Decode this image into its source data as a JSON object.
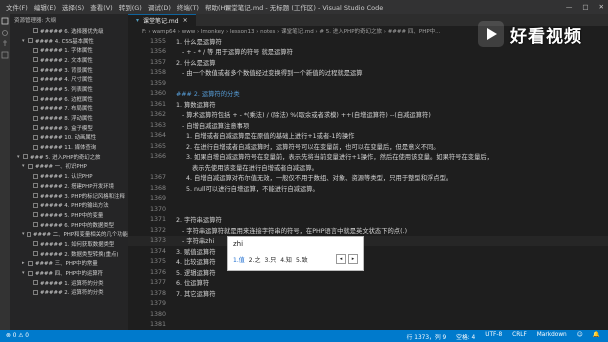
{
  "titlebar": {
    "menu": [
      "文件(F)",
      "编辑(E)",
      "选择(S)",
      "查看(V)",
      "转到(G)",
      "调试(D)",
      "终端(T)",
      "帮助(H)"
    ],
    "title": "课堂笔记.md - 无标题 (工作区) - Visual Studio Code",
    "minimize": "—",
    "maximize": "□",
    "close": "✕"
  },
  "sidebar": {
    "header": "资源管理器: 大纲",
    "items": [
      {
        "label": "##### 6. 选择器优先级",
        "indent": 3
      },
      {
        "label": "#### 4. CSS基本属性",
        "indent": 2,
        "expanded": true
      },
      {
        "label": "##### 1. 字体属性",
        "indent": 3
      },
      {
        "label": "##### 2. 文本属性",
        "indent": 3
      },
      {
        "label": "##### 3. 背景属性",
        "indent": 3
      },
      {
        "label": "##### 4. 尺寸属性",
        "indent": 3
      },
      {
        "label": "##### 5. 列表属性",
        "indent": 3
      },
      {
        "label": "##### 6. 边框属性",
        "indent": 3
      },
      {
        "label": "##### 7. 布局属性",
        "indent": 3
      },
      {
        "label": "##### 8. 浮动属性",
        "indent": 3
      },
      {
        "label": "##### 9. 盒子模型",
        "indent": 3
      },
      {
        "label": "##### 10. 动画属性",
        "indent": 3
      },
      {
        "label": "##### 11. 媒体查询",
        "indent": 3
      },
      {
        "label": "### 5. 进入PHP的奇幻之旅",
        "indent": 1,
        "expanded": true
      },
      {
        "label": "#### 一、初识PHP",
        "indent": 2,
        "expanded": true
      },
      {
        "label": "##### 1. 认识PHP",
        "indent": 3
      },
      {
        "label": "##### 2. 搭建PHP开发环境",
        "indent": 3
      },
      {
        "label": "##### 3. PHP的标记风格和注释",
        "indent": 3
      },
      {
        "label": "##### 4. PHP的输出方法",
        "indent": 3
      },
      {
        "label": "##### 5. PHP中的变量",
        "indent": 3
      },
      {
        "label": "##### 6. PHP中的数据类型",
        "indent": 3
      },
      {
        "label": "#### 二、PHP和变量相关的几个功能",
        "indent": 2,
        "expanded": true
      },
      {
        "label": "##### 1. 如何获取数据类型",
        "indent": 3
      },
      {
        "label": "##### 2. 数据类型转换(重点)",
        "indent": 3
      },
      {
        "label": "#### 三、PHP中的常量",
        "indent": 2,
        "expanded": false
      },
      {
        "label": "#### 四、PHP中的运算符",
        "indent": 2,
        "expanded": true
      },
      {
        "label": "##### 1. 运算符的分类",
        "indent": 3
      },
      {
        "label": "##### 2. 运算符的分类",
        "indent": 3
      }
    ]
  },
  "tabs": [
    {
      "label": "课堂笔记.md",
      "close": "×"
    }
  ],
  "breadcrumb": "F: › wamp64 › www › lmonkey › lesson13 › notes › 课堂笔记.md › # 5. 进入PHP的奇幻之旅 › #### 四、PHP中...",
  "editor": {
    "lines": [
      {
        "n": "1355",
        "text": "1. 什么是运算符",
        "style": "normal"
      },
      {
        "n": "1356",
        "text": "   - + - * / 等 用于运算的符号 就是运算符",
        "style": "normal"
      },
      {
        "n": "1357",
        "text": "2. 什么是运算",
        "style": "normal"
      },
      {
        "n": "1358",
        "text": "   - 由一个数值或者多个数值经过变换得到一个新值的过程就是运算",
        "style": "normal"
      },
      {
        "n": "1359",
        "text": "",
        "style": "normal"
      },
      {
        "n": "1360",
        "text": "### 2. 运算符的分类",
        "style": "heading"
      },
      {
        "n": "1361",
        "text": "1. 算数运算符",
        "style": "normal"
      },
      {
        "n": "1362",
        "text": "   - 算术运算符包括 + - *(乘法) / (除法) %(取余或者求模) ++(自增运算符) --(自减运算符)",
        "style": "normal"
      },
      {
        "n": "1363",
        "text": "   - 自增自减运算注意事项",
        "style": "normal"
      },
      {
        "n": "1364",
        "text": "     1. 自增或者自减运算是在原值的基础上进行+1或者-1的操作",
        "style": "normal"
      },
      {
        "n": "1365",
        "text": "     2. 在进行自增或者自减运算时，运算符号可以在变量前，也可以在变量后，但是意义不同。",
        "style": "normal"
      },
      {
        "n": "1366",
        "text": "     3. 如果自增自减运算符号在变量前，表示先将当前变量进行+1操作，然后在使用该变量。如果符号在变量后，",
        "style": "normal"
      },
      {
        "n": "",
        "text": "        表示先使用该变量在进行自增或者自减运算。",
        "style": "normal"
      },
      {
        "n": "1367",
        "text": "     4. 自增自减运算对布尔值无效，一般仅不用于数组、对象、资源等类型，只用于整型和浮点型。",
        "style": "normal"
      },
      {
        "n": "1368",
        "text": "     5. null可以进行自增运算，不能进行自减运算。",
        "style": "normal"
      },
      {
        "n": "1369",
        "text": "",
        "style": "normal"
      },
      {
        "n": "1370",
        "text": "",
        "style": "normal"
      },
      {
        "n": "1371",
        "text": "2. 字符串运算符",
        "style": "normal"
      },
      {
        "n": "1372",
        "text": "   - 字符串运算符就是用来连接字符串的符号，在PHP语言中就是英文状态下的点(.)",
        "style": "normal"
      },
      {
        "n": "1373",
        "text": "   - 字符串zhi",
        "style": "current"
      },
      {
        "n": "1374",
        "text": "3. 赋值运算符",
        "style": "normal"
      },
      {
        "n": "1375",
        "text": "4. 比较运算符",
        "style": "normal"
      },
      {
        "n": "1376",
        "text": "5. 逻辑运算符",
        "style": "normal"
      },
      {
        "n": "1377",
        "text": "6. 位运算符",
        "style": "normal"
      },
      {
        "n": "1378",
        "text": "7. 其它运算符",
        "style": "normal"
      },
      {
        "n": "1379",
        "text": "",
        "style": "normal"
      },
      {
        "n": "1380",
        "text": "",
        "style": "normal"
      },
      {
        "n": "1381",
        "text": "",
        "style": "normal"
      }
    ]
  },
  "ime": {
    "input": "zhi",
    "candidates": [
      "1.值",
      "2.之",
      "3.只",
      "4.知",
      "5.致"
    ],
    "prev": "◂",
    "next": "▸"
  },
  "statusbar": {
    "left": [
      "⊗ 0 ⚠ 0"
    ],
    "right": [
      "行 1373，列 9",
      "空格: 4",
      "UTF-8",
      "CRLF",
      "Markdown",
      "☺",
      "🔔"
    ]
  },
  "watermark": {
    "text": "好看视频"
  },
  "colors": {
    "status": "#007acc",
    "heading": "#569cd6",
    "editor_bg": "#1e1e1e",
    "sidebar_bg": "#252526"
  }
}
